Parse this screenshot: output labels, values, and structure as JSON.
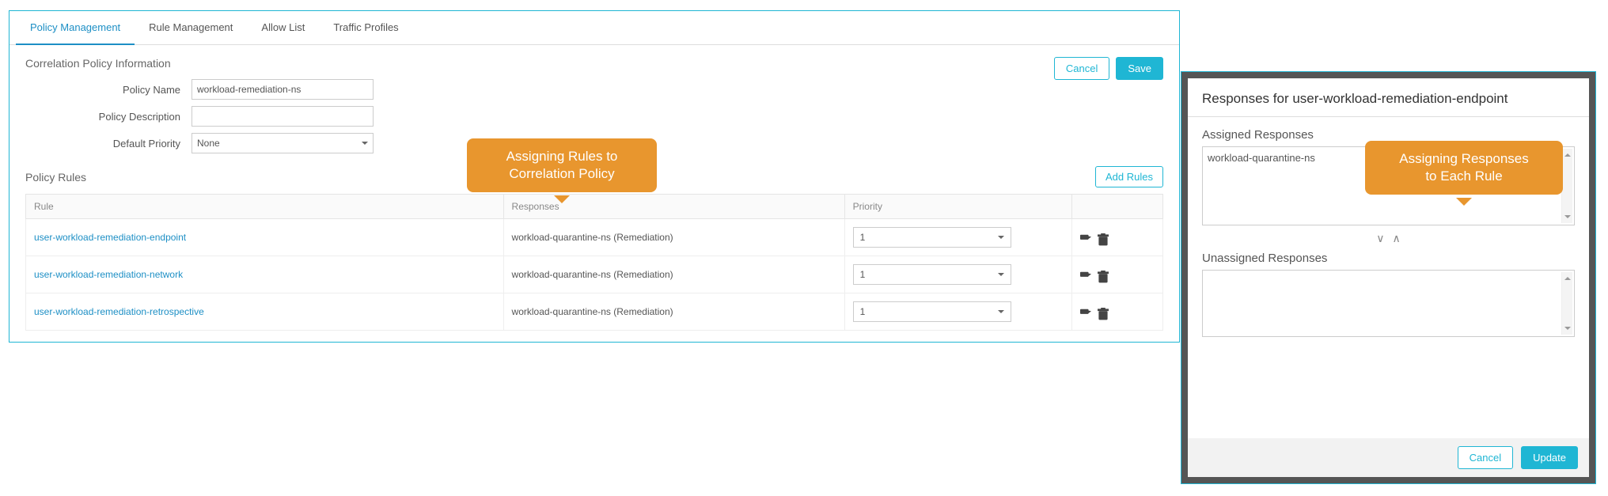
{
  "tabs": {
    "policy_management": "Policy Management",
    "rule_management": "Rule Management",
    "allow_list": "Allow List",
    "traffic_profiles": "Traffic Profiles"
  },
  "actions": {
    "cancel": "Cancel",
    "save": "Save",
    "add_rules": "Add Rules",
    "update": "Update"
  },
  "policy_info": {
    "section_title": "Correlation Policy Information",
    "name_label": "Policy Name",
    "name_value": "workload-remediation-ns",
    "desc_label": "Policy Description",
    "desc_value": "",
    "priority_label": "Default Priority",
    "priority_value": "None"
  },
  "policy_rules": {
    "section_title": "Policy Rules",
    "columns": {
      "rule": "Rule",
      "responses": "Responses",
      "priority": "Priority"
    },
    "rows": [
      {
        "rule": "user-workload-remediation-endpoint",
        "responses": "workload-quarantine-ns (Remediation)",
        "priority": "1"
      },
      {
        "rule": "user-workload-remediation-network",
        "responses": "workload-quarantine-ns (Remediation)",
        "priority": "1"
      },
      {
        "rule": "user-workload-remediation-retrospective",
        "responses": "workload-quarantine-ns (Remediation)",
        "priority": "1"
      }
    ]
  },
  "callouts": {
    "main_line1": "Assigning Rules to",
    "main_line2": "Correlation Policy",
    "side_line1": "Assigning Responses",
    "side_line2": "to Each Rule"
  },
  "side_panel": {
    "title": "Responses for user-workload-remediation-endpoint",
    "assigned_title": "Assigned Responses",
    "assigned_item": "workload-quarantine-ns",
    "unassigned_title": "Unassigned Responses"
  }
}
